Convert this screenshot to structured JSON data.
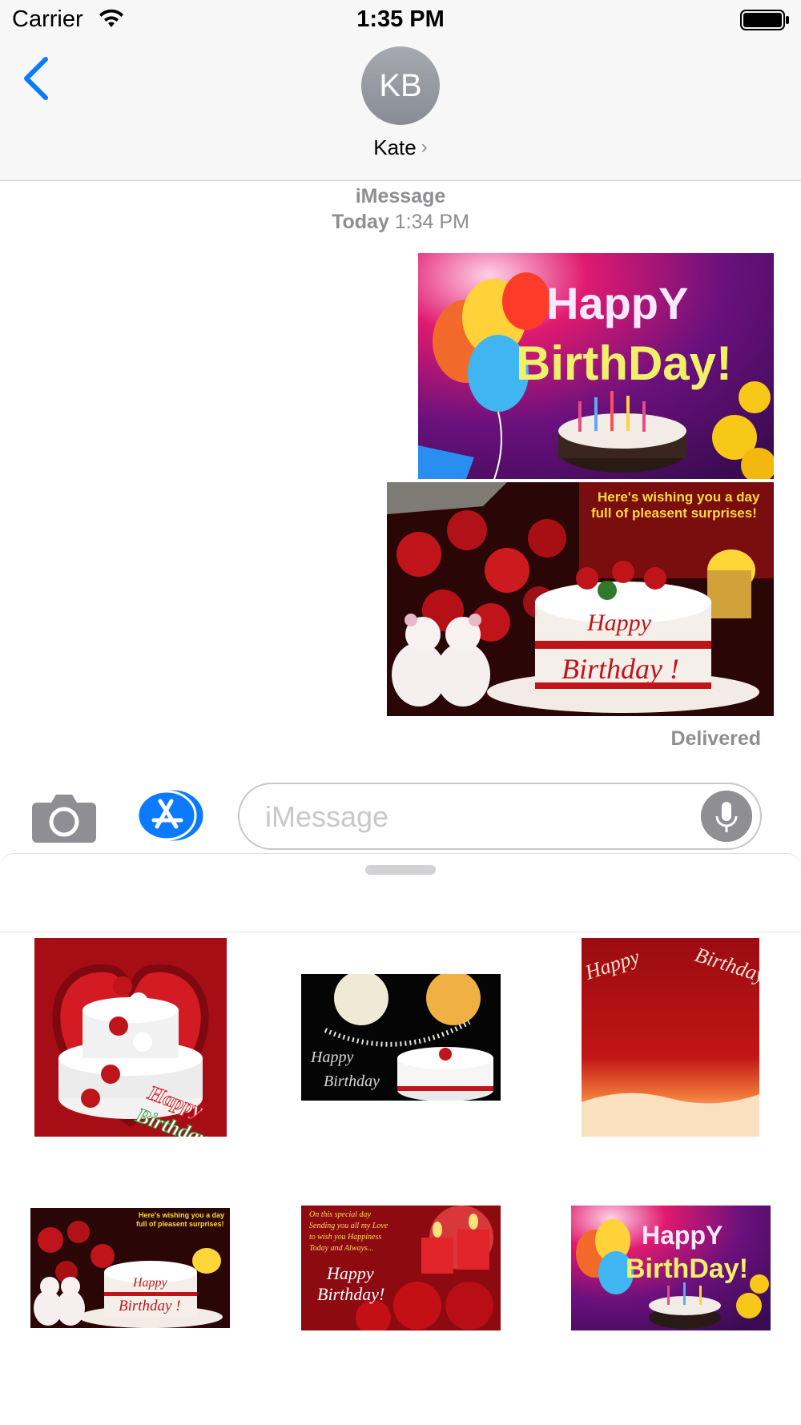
{
  "status_bar": {
    "carrier": "Carrier",
    "time": "1:35 PM"
  },
  "header": {
    "avatar_initials": "KB",
    "contact_name": "Kate",
    "chevron": "›"
  },
  "conversation": {
    "service": "iMessage",
    "timestamp_day": "Today",
    "timestamp_time": "1:34 PM",
    "messages": [
      {
        "type": "image",
        "text_lines": [
          "HappY",
          "BirthDay!"
        ]
      },
      {
        "type": "image",
        "caption_lines": [
          "Here's wishing you a day",
          "full of pleasent surprises!"
        ],
        "cake_lines": [
          "Happy",
          "Birthday !"
        ]
      }
    ],
    "delivery_status": "Delivered"
  },
  "input_bar": {
    "placeholder": "iMessage"
  },
  "sticker_drawer": {
    "items": [
      {
        "lines": [
          "Happy",
          "Birthday"
        ]
      },
      {
        "lines": [
          "Happy",
          "Birthday"
        ]
      },
      {
        "lines": [
          "Happy",
          "Birthday"
        ]
      },
      {
        "caption_lines": [
          "Here's wishing you a day",
          "full of pleasent surprises!"
        ],
        "cake_lines": [
          "Happy",
          "Birthday !"
        ]
      },
      {
        "poem_lines": [
          "On this special day",
          "Sending you all my Love",
          "to wish you Happiness",
          "Today and Always..."
        ],
        "lines": [
          "Happy",
          "Birthday!"
        ]
      },
      {
        "lines": [
          "HappY",
          "BirthDay!"
        ]
      }
    ]
  },
  "colors": {
    "accent": "#0a7aff",
    "delivered": "#8e8e93",
    "red": "#c0141b"
  },
  "icons": [
    "back-chevron-icon",
    "wifi-icon",
    "battery-icon",
    "camera-icon",
    "app-store-icon",
    "microphone-icon"
  ]
}
